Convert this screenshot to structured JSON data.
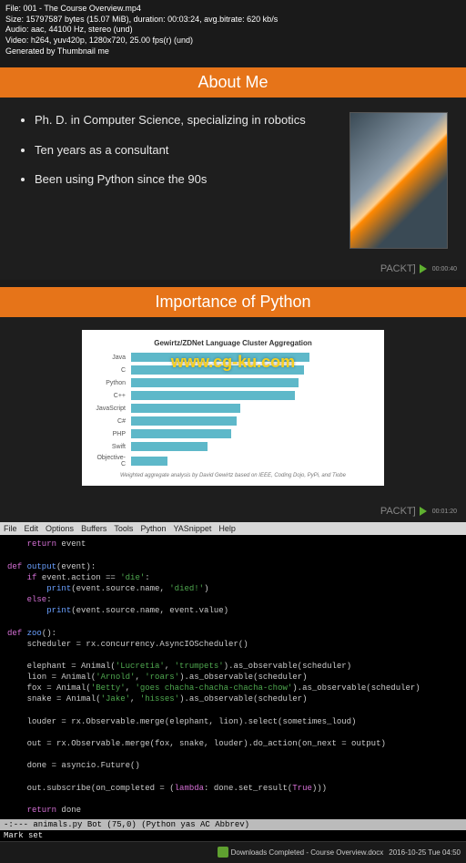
{
  "metadata": {
    "line1": "File: 001 - The Course Overview.mp4",
    "line2": "Size: 15797587 bytes (15.07 MiB), duration: 00:03:24, avg.bitrate: 620 kb/s",
    "line3": "Audio: aac, 44100 Hz, stereo (und)",
    "line4": "Video: h264, yuv420p, 1280x720, 25.00 fps(r) (und)",
    "line5": "Generated by Thumbnail me"
  },
  "slide1": {
    "title": "About Me",
    "bullets": [
      "Ph. D. in Computer Science, specializing in robotics",
      "Ten years as a consultant",
      "Been using Python since the 90s"
    ]
  },
  "slide2": {
    "title": "Importance of Python"
  },
  "packt": {
    "label": "PACKT]",
    "ts1": "00:00:40",
    "ts2": "00:01:20"
  },
  "watermark": "www.cg-ku.com",
  "chart_data": {
    "type": "bar",
    "title": "Gewirtz/ZDNet Language Cluster Aggregation",
    "categories": [
      "Java",
      "C",
      "Python",
      "C++",
      "JavaScript",
      "C#",
      "PHP",
      "Swift",
      "Objective-C"
    ],
    "values": [
      98,
      95,
      92,
      90,
      60,
      58,
      55,
      42,
      20
    ],
    "xlim": [
      0,
      100
    ],
    "footer": "Weighted aggregate analysis by David Gewirtz based on IEEE, Coding Dojo, PyPi, and Tiobe"
  },
  "menubar": [
    "File",
    "Edit",
    "Options",
    "Buffers",
    "Tools",
    "Python",
    "YASnippet",
    "Help"
  ],
  "code": {
    "l0": "    return event",
    "l1": "def output(event):",
    "l2": "    if event.action == 'die':",
    "l3": "        print(event.source.name, 'died!')",
    "l4": "    else:",
    "l5": "        print(event.source.name, event.value)",
    "l6": "def zoo():",
    "l7": "    scheduler = rx.concurrency.AsyncIOScheduler()",
    "l8": "    elephant = Animal('Lucretia', 'trumpets').as_observable(scheduler)",
    "l9": "    lion = Animal('Arnold', 'roars').as_observable(scheduler)",
    "l10": "    fox = Animal('Betty', 'goes chacha-chacha-chacha-chow').as_observable(scheduler)",
    "l11": "    snake = Animal('Jake', 'hisses').as_observable(scheduler)",
    "l12": "    louder = rx.Observable.merge(elephant, lion).select(sometimes_loud)",
    "l13": "    out = rx.Observable.merge(fox, snake, louder).do_action(on_next = output)",
    "l14": "    done = asyncio.Future()",
    "l15": "    out.subscribe(on_completed = (lambda: done.set_result(True)))",
    "l16": "    return done"
  },
  "status": "-:---  animals.py    Bot (75,0)    (Python yas AC Abbrev)",
  "mark": "Mark set",
  "taskbar": {
    "dl": "Downloads Completed - Course Overview.docx",
    "time": "2016-10-25 Tue 04:50"
  }
}
